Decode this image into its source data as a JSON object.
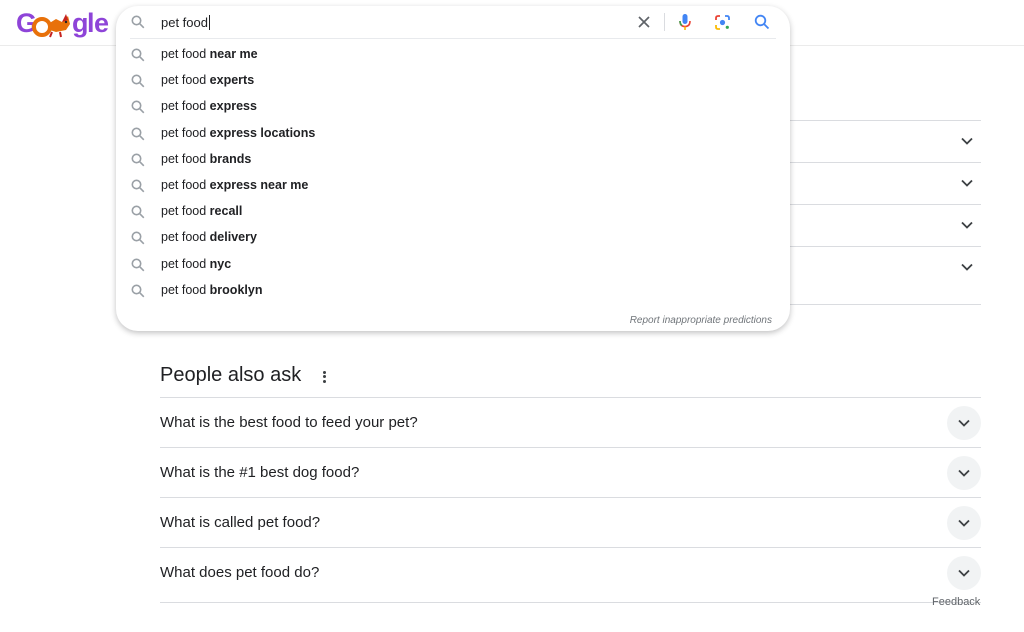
{
  "logo": {
    "text_parts": [
      "G",
      "g",
      "l",
      "e"
    ],
    "doodle": "fox-doodle"
  },
  "search": {
    "query": "pet food",
    "icons": {
      "leading": "search-icon",
      "clear": "close-icon",
      "voice": "mic-icon",
      "lens": "lens-icon",
      "submit": "search-icon"
    }
  },
  "suggestions": [
    {
      "prefix": "pet food",
      "completion": "near me"
    },
    {
      "prefix": "pet food",
      "completion": "experts"
    },
    {
      "prefix": "pet food",
      "completion": "express"
    },
    {
      "prefix": "pet food",
      "completion": "express locations"
    },
    {
      "prefix": "pet food",
      "completion": "brands"
    },
    {
      "prefix": "pet food",
      "completion": "express near me"
    },
    {
      "prefix": "pet food",
      "completion": "recall"
    },
    {
      "prefix": "pet food",
      "completion": "delivery"
    },
    {
      "prefix": "pet food",
      "completion": "nyc"
    },
    {
      "prefix": "pet food",
      "completion": "brooklyn"
    }
  ],
  "report_link": "Report inappropriate predictions",
  "people_also_ask": {
    "title": "People also ask",
    "questions": [
      "What is the best food to feed your pet?",
      "What is the #1 best dog food?",
      "What is called pet food?",
      "What does pet food do?"
    ]
  },
  "feedback": "Feedback",
  "colors": {
    "accent_blue": "#4285f4",
    "logo_purple": "#8e44d8",
    "text": "#202124",
    "muted": "#70757a"
  }
}
